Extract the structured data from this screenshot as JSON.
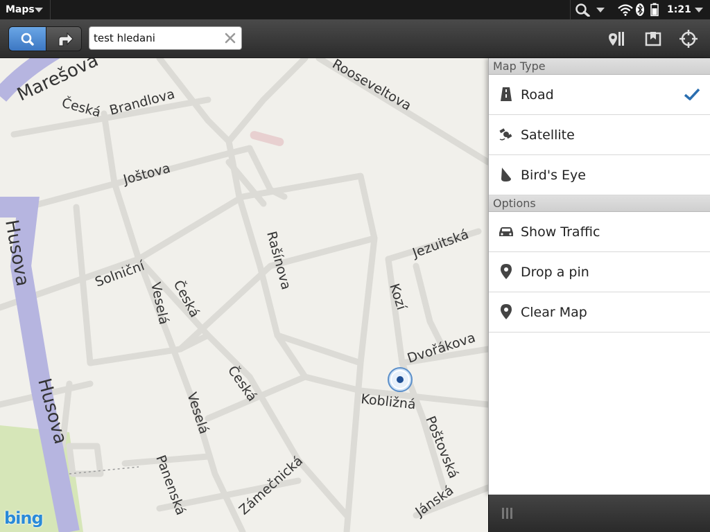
{
  "status_bar": {
    "app_title": "Maps",
    "time": "1:21",
    "icons": [
      "search-icon",
      "wifi-icon",
      "bluetooth-icon",
      "battery-icon"
    ]
  },
  "toolbar": {
    "mode_buttons": [
      "search-icon",
      "directions-icon"
    ],
    "active_mode": "search",
    "search_value": "test hledani",
    "right_buttons": [
      "nearby-icon",
      "bookmarks-icon",
      "locate-icon"
    ]
  },
  "map": {
    "provider": "bing",
    "streets": [
      "Marešova",
      "Česká",
      "Brandlova",
      "Rooseveltova",
      "Joštova",
      "Husova",
      "Husova",
      "Solniční",
      "Rašínova",
      "Jezuitská",
      "Veselá",
      "Česká",
      "Kozí",
      "Dvořákova",
      "Česká",
      "Kobližná",
      "Veselá",
      "Poštovská",
      "Panenská",
      "Zámečnická",
      "Jánská"
    ]
  },
  "panel": {
    "map_type_header": "Map Type",
    "map_types": [
      {
        "label": "Road",
        "icon": "road-icon",
        "selected": true
      },
      {
        "label": "Satellite",
        "icon": "satellite-icon",
        "selected": false
      },
      {
        "label": "Bird's Eye",
        "icon": "birds-eye-icon",
        "selected": false
      }
    ],
    "options_header": "Options",
    "options": [
      {
        "label": "Show Traffic",
        "icon": "traffic-car-icon"
      },
      {
        "label": "Drop a pin",
        "icon": "pin-icon"
      },
      {
        "label": "Clear Map",
        "icon": "pin-icon"
      }
    ]
  },
  "colors": {
    "accent": "#3a74c0",
    "major_road": "#b6b5e0",
    "minor_road": "#dcdcdc",
    "park": "#d6e6b8",
    "check": "#2a6eb0"
  }
}
